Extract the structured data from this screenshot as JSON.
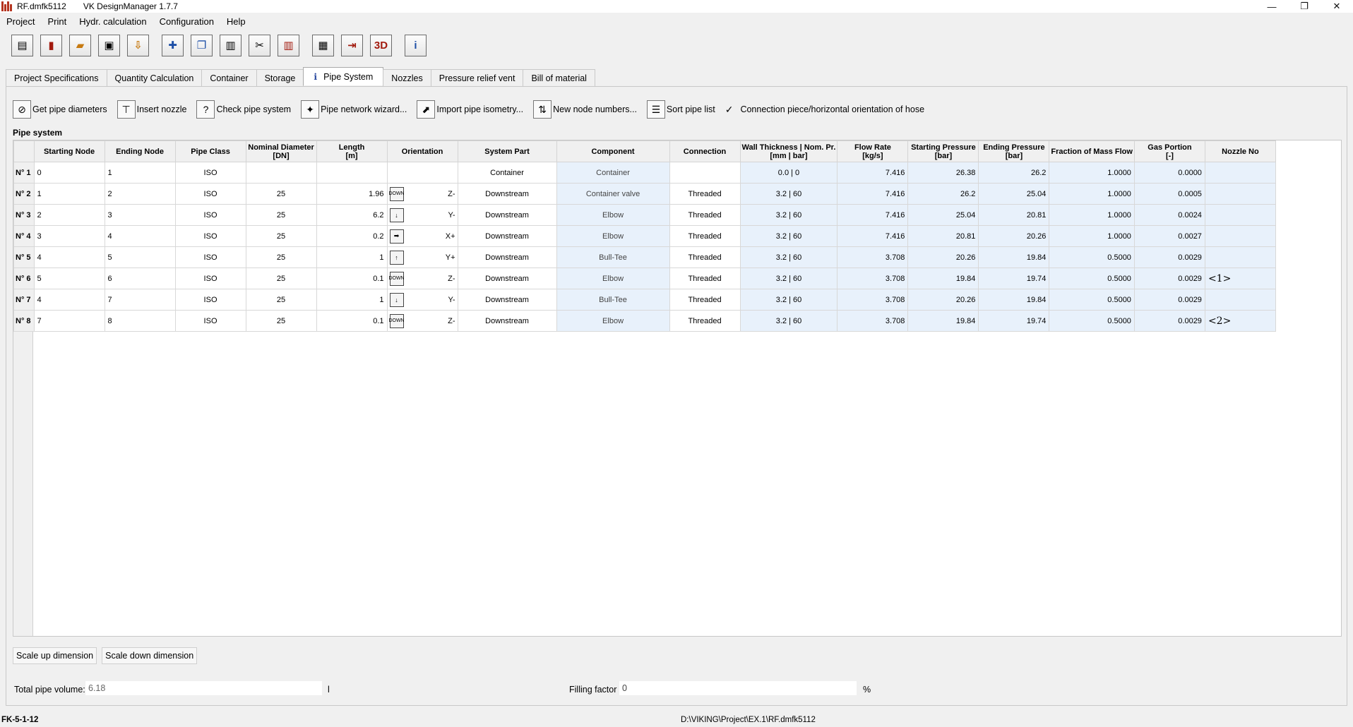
{
  "window": {
    "file_name": "RF.dmfk5112",
    "app_name": "VK DesignManager 1.7.7",
    "controls": {
      "minimize": "—",
      "restore": "❐",
      "close": "✕"
    }
  },
  "menu": [
    "Project",
    "Print",
    "Hydr. calculation",
    "Configuration",
    "Help"
  ],
  "toolbar": {
    "icons": [
      "new-document-icon",
      "open-file-icon",
      "folder-icon",
      "save-icon",
      "import-icon",
      "add-icon",
      "copy-icon",
      "paste-icon",
      "cut-icon",
      "delete-icon",
      "calculator-icon",
      "export-icon",
      "3d-view-icon",
      "info-icon"
    ],
    "three_d_label": "3D",
    "info_label": "i"
  },
  "tabs": [
    "Project Specifications",
    "Quantity Calculation",
    "Container",
    "Storage",
    "Pipe System",
    "Nozzles",
    "Pressure relief vent",
    "Bill of material"
  ],
  "active_tab_index": 4,
  "actions": {
    "get_pipe_diameters": "Get pipe diameters",
    "insert_nozzle": "Insert nozzle",
    "check_pipe_system": "Check pipe system",
    "pipe_network_wizard": "Pipe network wizard...",
    "import_pipe_isometry": "Import pipe isometry...",
    "new_node_numbers": "New node numbers...",
    "sort_pipe_list": "Sort pipe list",
    "connection_checkbox_label": "Connection piece/horizontal orientation of hose",
    "connection_checked": true
  },
  "section_title": "Pipe system",
  "table": {
    "columns": [
      {
        "l1": "",
        "l2": ""
      },
      {
        "l1": "Starting Node",
        "l2": ""
      },
      {
        "l1": "Ending Node",
        "l2": ""
      },
      {
        "l1": "Pipe Class",
        "l2": ""
      },
      {
        "l1": "Nominal Diameter",
        "l2": "[DN]"
      },
      {
        "l1": "Length",
        "l2": "[m]"
      },
      {
        "l1": "Orientation",
        "l2": ""
      },
      {
        "l1": "System Part",
        "l2": ""
      },
      {
        "l1": "Component",
        "l2": ""
      },
      {
        "l1": "Connection",
        "l2": ""
      },
      {
        "l1": "Wall Thickness | Nom. Pr.",
        "l2": "[mm | bar]"
      },
      {
        "l1": "Flow Rate",
        "l2": "[kg/s]"
      },
      {
        "l1": "Starting Pressure",
        "l2": "[bar]"
      },
      {
        "l1": "Ending Pressure",
        "l2": "[bar]"
      },
      {
        "l1": "Fraction of Mass Flow",
        "l2": ""
      },
      {
        "l1": "Gas Portion",
        "l2": "[-]"
      },
      {
        "l1": "Nozzle No",
        "l2": ""
      }
    ],
    "rows": [
      {
        "id": "N° 1",
        "start": "0",
        "end": "1",
        "cls": "ISO",
        "dn": "",
        "len": "",
        "ori_icon": "",
        "ori": "",
        "part": "Container",
        "comp": "Container",
        "conn": "",
        "wt": "0.0 | 0",
        "flow": "7.416",
        "sp": "26.38",
        "ep": "26.2",
        "frac": "1.0000",
        "gas": "0.0000",
        "nozzle": ""
      },
      {
        "id": "N° 2",
        "start": "1",
        "end": "2",
        "cls": "ISO",
        "dn": "25",
        "len": "1.96",
        "ori_icon": "DOWN",
        "ori": "Z-",
        "part": "Downstream",
        "comp": "Container valve",
        "conn": "Threaded",
        "wt": "3.2 | 60",
        "flow": "7.416",
        "sp": "26.2",
        "ep": "25.04",
        "frac": "1.0000",
        "gas": "0.0005",
        "nozzle": ""
      },
      {
        "id": "N° 3",
        "start": "2",
        "end": "3",
        "cls": "ISO",
        "dn": "25",
        "len": "6.2",
        "ori_icon": "↓",
        "ori": "Y-",
        "part": "Downstream",
        "comp": "Elbow",
        "conn": "Threaded",
        "wt": "3.2 | 60",
        "flow": "7.416",
        "sp": "25.04",
        "ep": "20.81",
        "frac": "1.0000",
        "gas": "0.0024",
        "nozzle": ""
      },
      {
        "id": "N° 4",
        "start": "3",
        "end": "4",
        "cls": "ISO",
        "dn": "25",
        "len": "0.2",
        "ori_icon": "➡",
        "ori": "X+",
        "part": "Downstream",
        "comp": "Elbow",
        "conn": "Threaded",
        "wt": "3.2 | 60",
        "flow": "7.416",
        "sp": "20.81",
        "ep": "20.26",
        "frac": "1.0000",
        "gas": "0.0027",
        "nozzle": ""
      },
      {
        "id": "N° 5",
        "start": "4",
        "end": "5",
        "cls": "ISO",
        "dn": "25",
        "len": "1",
        "ori_icon": "↑",
        "ori": "Y+",
        "part": "Downstream",
        "comp": "Bull-Tee",
        "conn": "Threaded",
        "wt": "3.2 | 60",
        "flow": "3.708",
        "sp": "20.26",
        "ep": "19.84",
        "frac": "0.5000",
        "gas": "0.0029",
        "nozzle": ""
      },
      {
        "id": "N° 6",
        "start": "5",
        "end": "6",
        "cls": "ISO",
        "dn": "25",
        "len": "0.1",
        "ori_icon": "DOWN",
        "ori": "Z-",
        "part": "Downstream",
        "comp": "Elbow",
        "conn": "Threaded",
        "wt": "3.2 | 60",
        "flow": "3.708",
        "sp": "19.84",
        "ep": "19.74",
        "frac": "0.5000",
        "gas": "0.0029",
        "nozzle": "<1>"
      },
      {
        "id": "N° 7",
        "start": "4",
        "end": "7",
        "cls": "ISO",
        "dn": "25",
        "len": "1",
        "ori_icon": "↓",
        "ori": "Y-",
        "part": "Downstream",
        "comp": "Bull-Tee",
        "conn": "Threaded",
        "wt": "3.2 | 60",
        "flow": "3.708",
        "sp": "20.26",
        "ep": "19.84",
        "frac": "0.5000",
        "gas": "0.0029",
        "nozzle": ""
      },
      {
        "id": "N° 8",
        "start": "7",
        "end": "8",
        "cls": "ISO",
        "dn": "25",
        "len": "0.1",
        "ori_icon": "DOWN",
        "ori": "Z-",
        "part": "Downstream",
        "comp": "Elbow",
        "conn": "Threaded",
        "wt": "3.2 | 60",
        "flow": "3.708",
        "sp": "19.84",
        "ep": "19.74",
        "frac": "0.5000",
        "gas": "0.0029",
        "nozzle": "<2>"
      }
    ]
  },
  "buttons": {
    "scale_up": "Scale up dimension",
    "scale_down": "Scale down dimension"
  },
  "totals": {
    "volume_label": "Total pipe volume:",
    "volume_value": "6.18",
    "volume_unit": "l",
    "filling_label": "Filling factor",
    "filling_value": "0",
    "filling_unit": "%"
  },
  "status": {
    "left": "FK-5-1-12",
    "path": "D:\\VIKING\\Project\\EX.1\\RF.dmfk5112"
  }
}
